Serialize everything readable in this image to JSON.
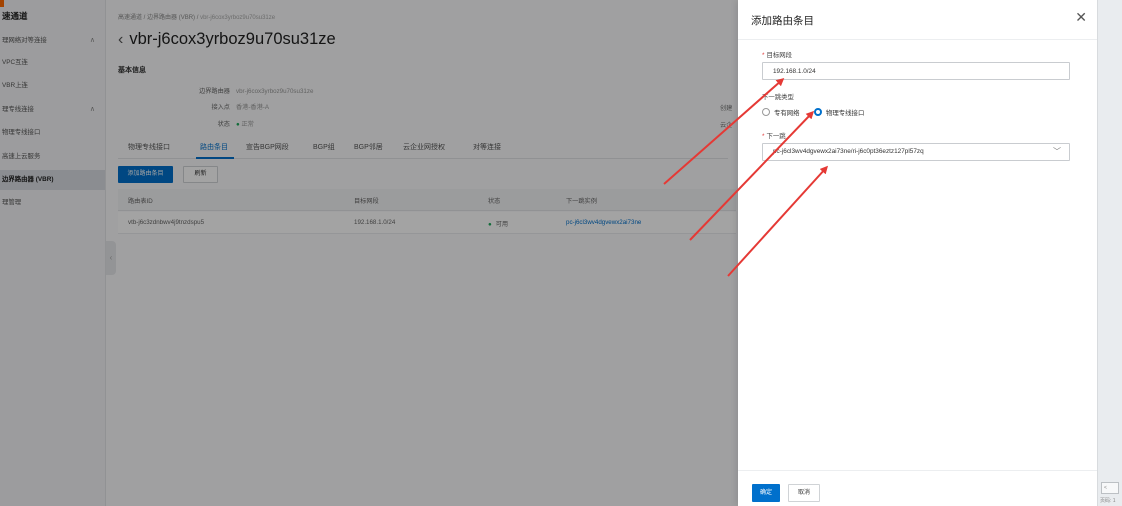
{
  "sidebar": {
    "title": "速通道",
    "items": [
      {
        "label": "理网络对等连接",
        "chevron": "∧"
      },
      {
        "label": "VPC互连",
        "chevron": ""
      },
      {
        "label": "VBR上连",
        "chevron": ""
      },
      {
        "label": "理专线连接",
        "chevron": "∧"
      },
      {
        "label": "物理专线接口",
        "chevron": ""
      },
      {
        "label": "高速上云服务",
        "chevron": ""
      },
      {
        "label": "边界路由器 (VBR)",
        "chevron": "",
        "active": true
      },
      {
        "label": "理管理",
        "chevron": ""
      }
    ]
  },
  "breadcrumb": {
    "part1": "高速通道",
    "sep1": " / ",
    "part2": "边界路由器 (VBR)",
    "sep2": " / ",
    "current": "vbr-j6cox3yrboz9u70su31ze"
  },
  "page": {
    "back_icon": "‹",
    "title": "vbr-j6cox3yrboz9u70su31ze",
    "section_title": "基本信息"
  },
  "basic_info": [
    {
      "key": "边界路由器",
      "value": "vbr-j6cox3yrboz9u70su31ze"
    },
    {
      "key": "接入点",
      "value": "香港-香港-A"
    },
    {
      "key": "状态",
      "dot": "●",
      "value": "正常"
    }
  ],
  "basic_info_cut": [
    "创建",
    "云企"
  ],
  "tabs": [
    "物理专线接口",
    "路由条目",
    "宣告BGP网段",
    "BGP组",
    "BGP邻居",
    "云企业网授权",
    "对等连接"
  ],
  "toolbar": {
    "add_label": "添加路由条目",
    "refresh_label": "刷新"
  },
  "table": {
    "headers": [
      "路由表ID",
      "目标网段",
      "状态",
      "下一跳实例"
    ],
    "rows": [
      {
        "id": "vtb-j6c3zdnbwv4j9tnzdspu5",
        "cidr": "192.168.1.0/24",
        "status_dot": "●",
        "status": "可用",
        "next_hop": "pc-j6cl3wv4dgvewx2ai73ne"
      }
    ]
  },
  "drawer": {
    "title": "添加路由条目",
    "close_icon": "✕",
    "required_mark": "*",
    "cidr_label": "目标网段",
    "cidr_value": "192.168.1.0/24",
    "hop_type_label": "下一跳类型",
    "radio_vpc": "专有网络",
    "radio_physical": "物理专线接口",
    "next_hop_label": "下一跳",
    "next_hop_value": "pc-j6cl3wv4dgvewx2ai73ne/ri-j6c0pt36eztz127pl57zq",
    "select_chevron": "﹀",
    "confirm_label": "确定",
    "cancel_label": "取消"
  },
  "right_strip": {
    "box_text": "< ",
    "footer_text": "页码: 1"
  },
  "colors": {
    "primary": "#0070cc",
    "annotation": "#e53935",
    "success": "#1eaa5c"
  }
}
